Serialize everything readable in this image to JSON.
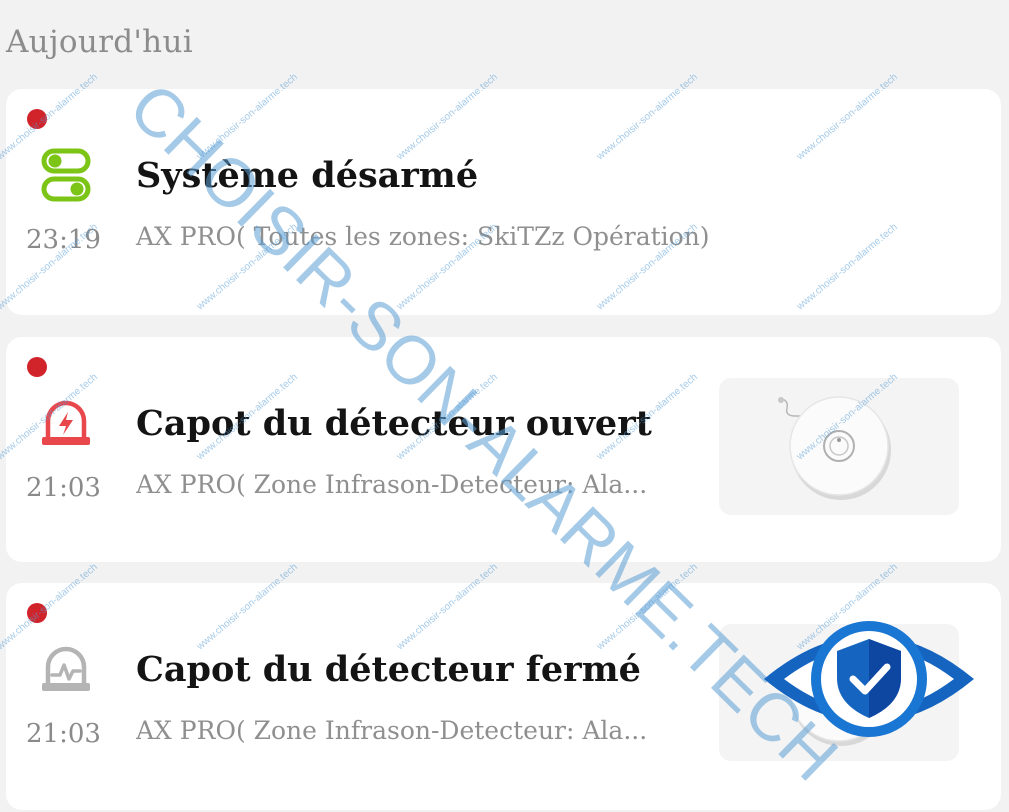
{
  "section": {
    "title": "Aujourd'hui"
  },
  "events": [
    {
      "icon": "system-disarmed-icon",
      "time": "23:19",
      "title": "Système désarmé",
      "subtitle": "AX PRO( Toutes les zones: SkiTZz Opération)",
      "unread": true,
      "has_thumbnail": false
    },
    {
      "icon": "tamper-alarm-icon",
      "time": "21:03",
      "title": "Capot du détecteur ouvert",
      "subtitle": "AX PRO( Zone Infrason-Detecteur: Ala...",
      "unread": true,
      "has_thumbnail": true
    },
    {
      "icon": "tamper-restored-icon",
      "time": "21:03",
      "title": "Capot du détecteur fermé",
      "subtitle": "AX PRO( Zone Infrason-Detecteur: Ala...",
      "unread": true,
      "has_thumbnail": true
    }
  ],
  "watermark": {
    "large_text": "CHOISIR-SON-ALARME.TECH",
    "small_text": "www.choisir-son-alarme.tech"
  },
  "colors": {
    "unread_dot": "#d1232a",
    "disarm_icon": "#7cc516",
    "alarm_icon": "#e8474c",
    "restored_icon": "#b4b4b4",
    "watermark": "#5b9fd6",
    "badge_blue": "#1565c0"
  }
}
